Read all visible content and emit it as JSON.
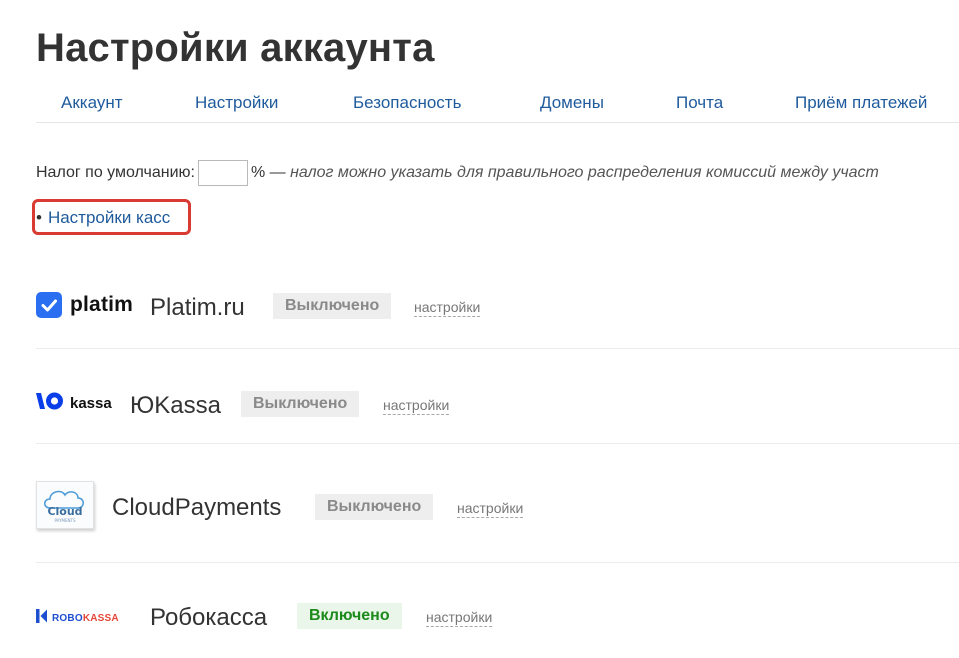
{
  "page": {
    "title": "Настройки аккаунта"
  },
  "tabs": [
    {
      "label": "Аккаунт"
    },
    {
      "label": "Настройки"
    },
    {
      "label": "Безопасность"
    },
    {
      "label": "Домены"
    },
    {
      "label": "Почта"
    },
    {
      "label": "Приём платежей"
    }
  ],
  "tax": {
    "label": "Налог по умолчанию:",
    "value": "",
    "unit": "% —",
    "hint": "налог можно указать для правильного распределения комиссий между участ"
  },
  "kassa_link": {
    "bullet": "•",
    "label": "Настройки касс"
  },
  "providers": [
    {
      "logo_text": "platim",
      "name": "Platim.ru",
      "status": "Выключено",
      "enabled": false,
      "settings_label": "настройки",
      "icon": "platim-check-icon"
    },
    {
      "logo_text": "kassa",
      "name": "ЮKassa",
      "status": "Выключено",
      "enabled": false,
      "settings_label": "настройки",
      "icon": "yookassa-logo-icon"
    },
    {
      "logo_text": "Cloud",
      "logo_subtext": "PAYMENTS",
      "name": "CloudPayments",
      "status": "Выключено",
      "enabled": false,
      "settings_label": "настройки",
      "icon": "cloud-icon"
    },
    {
      "logo_text_left": "ROBO",
      "logo_text_right": "KASSA",
      "name": "Робокасса",
      "status": "Включено",
      "enabled": true,
      "settings_label": "настройки",
      "icon": "robokassa-k-icon"
    }
  ],
  "colors": {
    "link": "#1f5b9c",
    "highlight_border": "#d93a32",
    "status_off_bg": "#eeeeee",
    "status_off_text": "#8a8a8a",
    "status_on_bg": "#eaf6e9",
    "status_on_text": "#1c8a1c",
    "platim_blue": "#2a6ff2",
    "yookassa_blue": "#0a3ee8",
    "robo_blue": "#1f4fd1",
    "robo_red": "#e5473a"
  }
}
